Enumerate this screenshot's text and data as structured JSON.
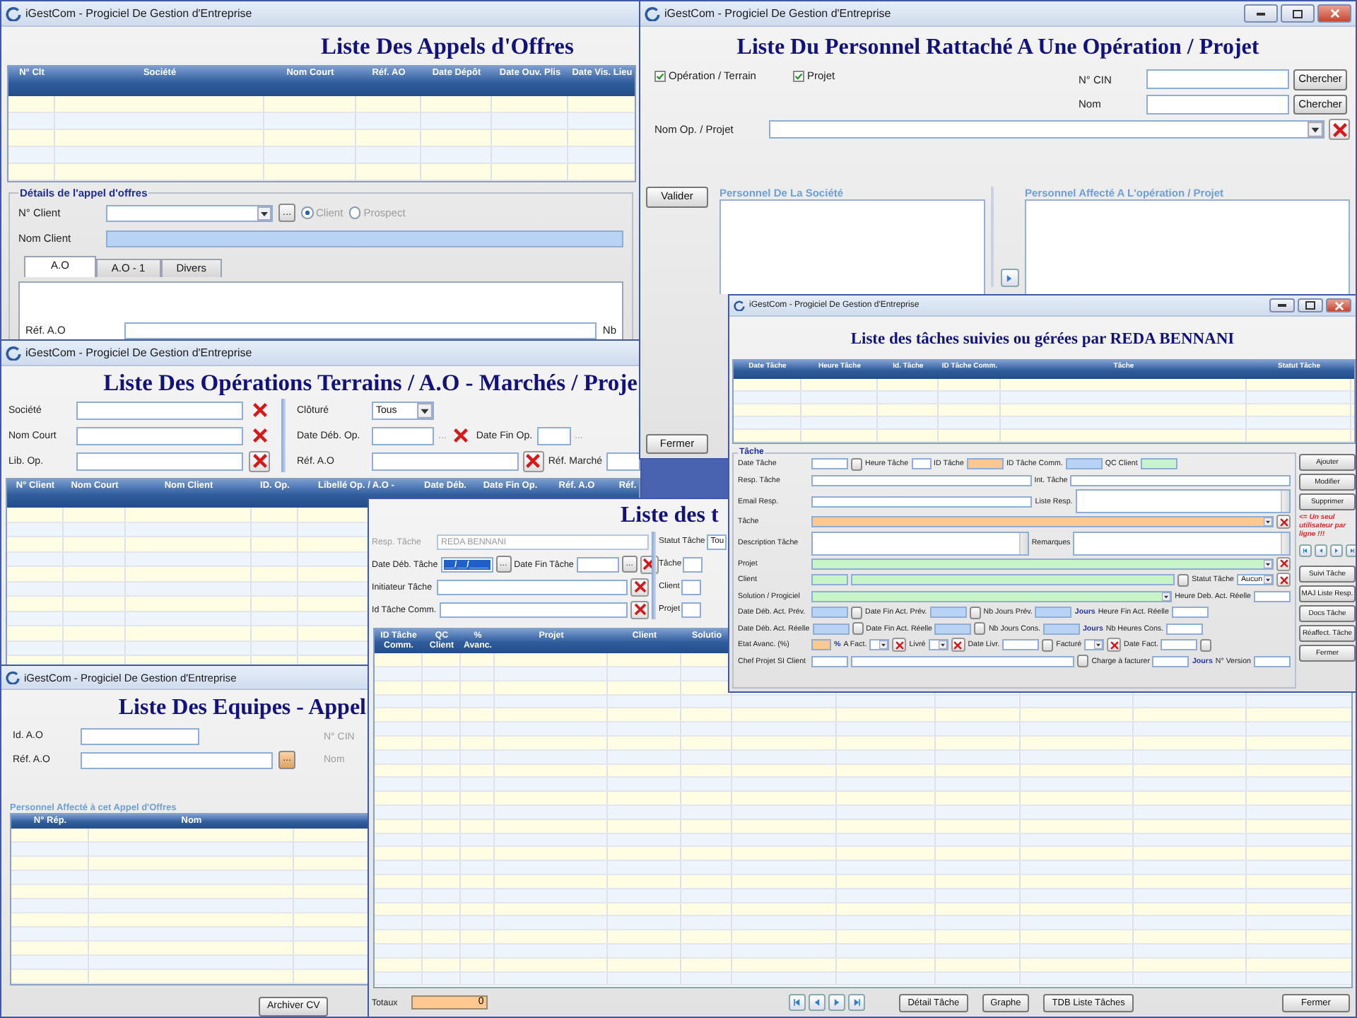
{
  "tenders": {
    "title": "iGestCom - Progiciel De Gestion d'Entreprise",
    "heading": "Liste Des Appels d'Offres",
    "grid": {
      "columns": [
        "N° Clt",
        "Société",
        "Nom Court",
        "Réf. AO",
        "Date Dépôt",
        "Date Ouv. Plis",
        "Date Vis. Lieu"
      ]
    },
    "details": {
      "legend": "Détails de l'appel d'offres",
      "rows": [
        {
          "items": [
            {
              "kind": "label",
              "text": "N° Client"
            },
            {
              "kind": "combo"
            },
            {
              "kind": "dots",
              "text": "..."
            },
            {
              "kind": "radio",
              "text": "Client",
              "selected": true
            },
            {
              "kind": "radio",
              "text": "Prospect",
              "selected": false
            }
          ]
        },
        {
          "items": [
            {
              "kind": "label",
              "text": "Nom Client"
            },
            {
              "kind": "wide_field",
              "color": "#b9d3f5"
            }
          ]
        }
      ],
      "tabs": [
        {
          "label": "A.O",
          "selected": true
        },
        {
          "label": "A.O - 1",
          "selected": false
        },
        {
          "label": "Divers",
          "selected": false
        }
      ],
      "tab_rows": [
        {
          "items": [
            {
              "kind": "label",
              "text": "Réf. A.O"
            },
            {
              "kind": "wide_field"
            },
            {
              "kind": "label",
              "text": "Nb"
            }
          ]
        }
      ]
    }
  },
  "operations": {
    "title": "iGestCom - Progiciel De Gestion d'Entreprise",
    "heading": "Liste Des Opérations Terrains / A.O - Marchés / Proje",
    "left_rows": [
      {
        "items": [
          {
            "kind": "label",
            "text": "Société"
          },
          {
            "kind": "wide_field"
          },
          {
            "kind": "x"
          }
        ]
      },
      {
        "items": [
          {
            "kind": "label",
            "text": "Nom Court"
          },
          {
            "kind": "wide_field"
          },
          {
            "kind": "x"
          }
        ]
      },
      {
        "items": [
          {
            "kind": "label",
            "text": "Lib. Op."
          },
          {
            "kind": "wide_field"
          },
          {
            "kind": "x_boxed"
          }
        ]
      }
    ],
    "right_rows": [
      {
        "items": [
          {
            "kind": "label",
            "text": "Clôturé"
          },
          {
            "kind": "combo",
            "value": "Tous"
          }
        ]
      },
      {
        "items": [
          {
            "kind": "label",
            "text": "Date Déb. Op."
          },
          {
            "kind": "field"
          },
          {
            "kind": "ellipsis",
            "text": "..."
          },
          {
            "kind": "x"
          },
          {
            "kind": "label",
            "text": "Date Fin Op."
          },
          {
            "kind": "short_field"
          },
          {
            "kind": "ellipsis",
            "text": "..."
          }
        ]
      },
      {
        "items": [
          {
            "kind": "label",
            "text": "Réf. A.O"
          },
          {
            "kind": "wide_field"
          },
          {
            "kind": "x_boxed"
          },
          {
            "kind": "label",
            "text": "Réf. Marché"
          },
          {
            "kind": "short_field"
          }
        ]
      }
    ],
    "grid": {
      "columns": [
        "N° Client",
        "Nom Court",
        "Nom Client",
        "ID. Op.",
        "Libellé Op. / A.O -",
        "Date Déb.",
        "Date Fin Op.",
        "Réf. A.O",
        "Réf."
      ]
    }
  },
  "teams": {
    "title": "iGestCom - Progiciel De Gestion d'Entreprise",
    "heading": "Liste Des Equipes - Appel",
    "rows": [
      {
        "items": [
          {
            "kind": "label",
            "text": "Id. A.O"
          },
          {
            "kind": "field"
          }
        ]
      },
      {
        "items": [
          {
            "kind": "label",
            "text": "Réf. A.O"
          },
          {
            "kind": "wide_field"
          },
          {
            "kind": "orange_dots",
            "text": "..."
          }
        ]
      }
    ],
    "side_labels": [
      "N° CIN",
      "Nom"
    ],
    "group_label": "Personnel Affecté à cet Appel d'Offres",
    "grid": {
      "columns": [
        "N° Rép.",
        "Nom"
      ]
    },
    "archive_button": "Archiver CV"
  },
  "task_list": {
    "heading": "Liste des t",
    "left_rows": [
      {
        "items": [
          {
            "kind": "muted_label",
            "text": "Resp. Tâche"
          },
          {
            "kind": "locked_field",
            "value": "REDA BENNANI"
          }
        ]
      },
      {
        "items": [
          {
            "kind": "label",
            "text": "Date Déb. Tâche"
          },
          {
            "kind": "masked_field",
            "value": "__/__/____"
          },
          {
            "kind": "dots",
            "text": "..."
          },
          {
            "kind": "label",
            "text": "Date Fin Tâche"
          },
          {
            "kind": "field"
          },
          {
            "kind": "dots",
            "text": "..."
          },
          {
            "kind": "x_boxed"
          }
        ]
      },
      {
        "items": [
          {
            "kind": "label",
            "text": "Initiateur Tâche"
          },
          {
            "kind": "wide_field"
          },
          {
            "kind": "x_boxed"
          }
        ]
      },
      {
        "items": [
          {
            "kind": "label",
            "text": "Id Tâche Comm."
          },
          {
            "kind": "wide_field"
          },
          {
            "kind": "x_boxed"
          }
        ]
      }
    ],
    "right_rows": [
      {
        "items": [
          {
            "kind": "label",
            "text": "Statut Tâche"
          },
          {
            "kind": "field",
            "value": "Tou"
          }
        ]
      },
      {
        "items": [
          {
            "kind": "label",
            "text": "Tâche"
          },
          {
            "kind": "field"
          }
        ]
      },
      {
        "items": [
          {
            "kind": "label",
            "text": "Client"
          },
          {
            "kind": "field"
          }
        ]
      },
      {
        "items": [
          {
            "kind": "label",
            "text": "Projet"
          },
          {
            "kind": "field"
          }
        ]
      }
    ],
    "grid": {
      "columns": [
        "ID Tâche Comm.",
        "QC Client",
        "% Avanc.",
        "Projet",
        "Client",
        "Solutio"
      ]
    },
    "totals": {
      "label": "Totaux",
      "value": "0",
      "color": "#ffc890"
    },
    "buttons": [
      "Détail Tâche",
      "Graphe",
      "TDB Liste Tâches"
    ],
    "close": "Fermer"
  },
  "staff": {
    "title": "iGestCom - Progiciel De Gestion d'Entreprise",
    "heading": "Liste Du Personnel Rattaché A Une Opération / Projet",
    "checks": [
      {
        "text": "Opération / Terrain",
        "checked": true
      },
      {
        "text": "Projet",
        "checked": true
      }
    ],
    "search_rows": [
      {
        "label": "N° CIN",
        "button": "Chercher"
      },
      {
        "label": "Nom",
        "button": "Chercher"
      }
    ],
    "project_label": "Nom Op. / Projet",
    "validate": "Valider",
    "lists": [
      "Personnel De La Société",
      "Personnel Affecté A L'opération / Projet"
    ],
    "close": "Fermer"
  },
  "task_detail": {
    "title": "iGestCom - Progiciel De Gestion d'Entreprise",
    "heading": "Liste des tâches suivies ou gérées par REDA BENNANI",
    "grid": {
      "columns": [
        "Date Tâche",
        "Heure Tâche",
        "Id. Tâche",
        "ID Tâche Comm.",
        "Tâche",
        "Statut Tâche"
      ]
    },
    "legend": "Tâche",
    "rows": [
      {
        "items": [
          {
            "kind": "label",
            "text": "Date Tâche"
          },
          {
            "kind": "field"
          },
          {
            "kind": "blank"
          },
          {
            "kind": "label",
            "text": "Heure Tâche"
          },
          {
            "kind": "short_field"
          },
          {
            "kind": "label",
            "text": "ID Tâche"
          },
          {
            "kind": "field",
            "color": "#ffc890"
          },
          {
            "kind": "label",
            "text": "ID Tâche Comm."
          },
          {
            "kind": "field",
            "color": "#b9d3f5"
          },
          {
            "kind": "label",
            "text": "QC Client"
          },
          {
            "kind": "field",
            "color": "#c8f5c8"
          }
        ]
      },
      {
        "items": [
          {
            "kind": "label",
            "text": "Resp. Tâche"
          },
          {
            "kind": "wide_field"
          },
          {
            "kind": "label",
            "text": "Int. Tâche"
          },
          {
            "kind": "wide_field"
          }
        ]
      },
      {
        "items": [
          {
            "kind": "label",
            "text": "Email Resp."
          },
          {
            "kind": "wide_field"
          },
          {
            "kind": "label",
            "text": "Liste Resp."
          },
          {
            "kind": "area"
          }
        ]
      },
      {
        "items": [
          {
            "kind": "label",
            "text": "Tâche"
          },
          {
            "kind": "wide_combo",
            "color": "#ffc890"
          },
          {
            "kind": "x_boxed"
          }
        ]
      },
      {
        "items": [
          {
            "kind": "label",
            "text": "Description Tâche"
          },
          {
            "kind": "area"
          },
          {
            "kind": "label",
            "text": "Remarques"
          },
          {
            "kind": "area"
          }
        ]
      },
      {
        "items": [
          {
            "kind": "label",
            "text": "Projet"
          },
          {
            "kind": "wide_combo",
            "color": "#c8f5c8"
          },
          {
            "kind": "x_boxed"
          }
        ]
      },
      {
        "items": [
          {
            "kind": "label",
            "text": "Client"
          },
          {
            "kind": "field",
            "color": "#c8f5c8"
          },
          {
            "kind": "wide_field",
            "color": "#c8f5c8"
          },
          {
            "kind": "blank"
          },
          {
            "kind": "label",
            "text": "Statut Tâche"
          },
          {
            "kind": "combo",
            "value": "Aucun"
          },
          {
            "kind": "x_boxed"
          }
        ]
      },
      {
        "items": [
          {
            "kind": "label",
            "text": "Solution / Progiciel"
          },
          {
            "kind": "wide_combo",
            "color": "#c8f5c8"
          },
          {
            "kind": "label",
            "text": "Heure Deb. Act. Réelle"
          },
          {
            "kind": "field"
          }
        ]
      },
      {
        "items": [
          {
            "kind": "label",
            "text": "Date Déb. Act. Prév."
          },
          {
            "kind": "field",
            "color": "#b9d3f5"
          },
          {
            "kind": "blank"
          },
          {
            "kind": "label",
            "text": "Date Fin Act. Prév."
          },
          {
            "kind": "field",
            "color": "#b9d3f5"
          },
          {
            "kind": "blank"
          },
          {
            "kind": "label",
            "text": "Nb Jours Prév."
          },
          {
            "kind": "field",
            "color": "#b9d3f5"
          },
          {
            "kind": "unit",
            "text": "Jours"
          },
          {
            "kind": "label",
            "text": "Heure Fin Act. Réelle"
          },
          {
            "kind": "field"
          }
        ]
      },
      {
        "items": [
          {
            "kind": "label",
            "text": "Date Déb. Act. Réelle"
          },
          {
            "kind": "field",
            "color": "#b9d3f5"
          },
          {
            "kind": "blank"
          },
          {
            "kind": "label",
            "text": "Date Fin Act. Réelle"
          },
          {
            "kind": "field",
            "color": "#b9d3f5"
          },
          {
            "kind": "blank"
          },
          {
            "kind": "label",
            "text": "Nb Jours Cons."
          },
          {
            "kind": "field",
            "color": "#b9d3f5"
          },
          {
            "kind": "unit",
            "text": "Jours"
          },
          {
            "kind": "label",
            "text": "Nb Heures Cons."
          },
          {
            "kind": "field"
          }
        ]
      },
      {
        "items": [
          {
            "kind": "label",
            "text": "Etat Avanc. (%)"
          },
          {
            "kind": "short_field",
            "color": "#ffc890"
          },
          {
            "kind": "unit",
            "text": "%"
          },
          {
            "kind": "label",
            "text": "A Fact."
          },
          {
            "kind": "short_combo"
          },
          {
            "kind": "x_boxed"
          },
          {
            "kind": "label",
            "text": "Livré"
          },
          {
            "kind": "short_combo"
          },
          {
            "kind": "x_boxed"
          },
          {
            "kind": "label",
            "text": "Date Livr."
          },
          {
            "kind": "field"
          },
          {
            "kind": "blank"
          },
          {
            "kind": "label",
            "text": "Facturé"
          },
          {
            "kind": "short_combo"
          },
          {
            "kind": "x_boxed"
          },
          {
            "kind": "label",
            "text": "Date Fact."
          },
          {
            "kind": "field"
          },
          {
            "kind": "blank"
          }
        ]
      },
      {
        "items": [
          {
            "kind": "label",
            "text": "Chef Projet SI Client"
          },
          {
            "kind": "field"
          },
          {
            "kind": "wide_field"
          },
          {
            "kind": "blank"
          },
          {
            "kind": "label",
            "text": "Charge à facturer"
          },
          {
            "kind": "field"
          },
          {
            "kind": "unit",
            "text": "Jours"
          },
          {
            "kind": "label",
            "text": "N° Version"
          },
          {
            "kind": "field"
          }
        ]
      }
    ],
    "side": [
      {
        "kind": "button",
        "text": "Ajouter"
      },
      {
        "kind": "button",
        "text": "Modifier"
      },
      {
        "kind": "button",
        "text": "Supprimer"
      },
      {
        "kind": "note",
        "text": "<= Un seul utilisateur par ligne !!!"
      },
      {
        "kind": "nav"
      },
      {
        "kind": "button",
        "text": "Suivi Tâche"
      },
      {
        "kind": "button",
        "text": "MAJ Liste Resp."
      },
      {
        "kind": "button",
        "text": "Docs Tâche"
      },
      {
        "kind": "button",
        "text": "Réaffect. Tâche"
      },
      {
        "kind": "button",
        "text": "Fermer"
      }
    ]
  }
}
